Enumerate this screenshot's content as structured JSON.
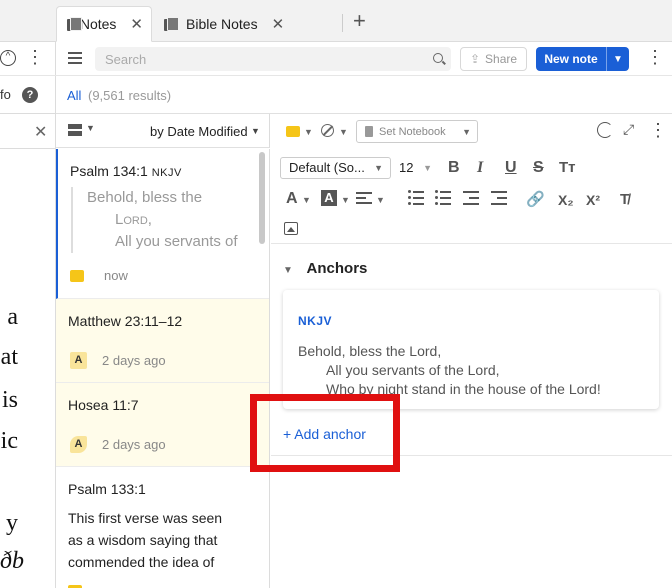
{
  "left_pane": {
    "fo_text": "fo",
    "help_label": "?",
    "text_lines": [
      "a",
      "at",
      "is",
      "ic",
      "",
      "y",
      "ðb"
    ]
  },
  "tabs": [
    {
      "label": "Notes",
      "active": true
    },
    {
      "label": "Bible Notes",
      "active": false
    }
  ],
  "toolbar": {
    "search_placeholder": "Search",
    "share_label": "Share",
    "new_note_label": "New note"
  },
  "results": {
    "filter_label": "All",
    "count_text": "(9,561 results)"
  },
  "list_header": {
    "sort_label": "by Date Modified"
  },
  "notes": [
    {
      "title": "Psalm 134:1",
      "version": "NKJV",
      "quote_lines": [
        "Behold, bless the",
        "Lord,",
        "All you servants of"
      ],
      "time": "now",
      "badge": "sticky"
    },
    {
      "title": "Matthew 23:11–12",
      "time": "2 days ago",
      "badge": "A"
    },
    {
      "title": "Hosea 11:7",
      "time": "2 days ago",
      "badge": "A"
    },
    {
      "title": "Psalm 133:1",
      "body_lines": [
        "This first verse was seen",
        "as a wisdom saying that",
        "commended the idea of"
      ]
    }
  ],
  "editor": {
    "notebook_label": "Set Notebook",
    "font_label": "Default (So...",
    "size_label": "12",
    "anchors_title": "Anchors",
    "anchor": {
      "version": "NKJV",
      "lines": [
        "Behold, bless the Lord,",
        "All you servants of the Lord,",
        "Who by night stand in the house of the Lord!"
      ]
    },
    "add_anchor_label": "+ Add anchor"
  },
  "colors": {
    "accent": "#1a5fd6",
    "sticky": "#f5c518",
    "highlight_box": "#e01010"
  }
}
